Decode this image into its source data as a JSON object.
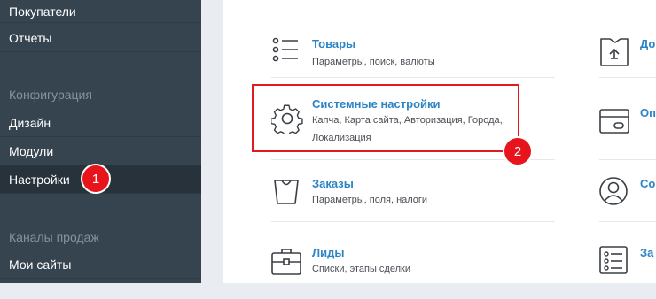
{
  "sidebar": {
    "items_top": [
      {
        "label": "Покупатели"
      },
      {
        "label": "Отчеты"
      }
    ],
    "section_config": "Конфигурация",
    "items_config": [
      {
        "label": "Дизайн"
      },
      {
        "label": "Модули"
      },
      {
        "label": "Настройки"
      }
    ],
    "section_sales": "Каналы продаж",
    "items_sales": [
      {
        "label": "Мои сайты"
      }
    ]
  },
  "markers": [
    "1",
    "2"
  ],
  "cards_left": [
    {
      "title": "Товары",
      "desc": "Параметры, поиск, валюты",
      "icon": "list-icon"
    },
    {
      "title": "Системные настройки",
      "desc_lines": [
        "Капча, Карта сайта, Авторизация, Города,",
        "Локализация"
      ],
      "icon": "gear-icon"
    },
    {
      "title": "Заказы",
      "desc": "Параметры, поля, налоги",
      "icon": "shopping-bag-icon"
    },
    {
      "title": "Лиды",
      "desc": "Списки, этапы сделки",
      "icon": "briefcase-icon"
    }
  ],
  "cards_right": [
    {
      "title": "До",
      "icon": "box-upload-icon"
    },
    {
      "title": "Оп",
      "icon": "credit-card-icon"
    },
    {
      "title": "Со",
      "icon": "user-circle-icon"
    },
    {
      "title": "За",
      "icon": "checklist-icon"
    }
  ],
  "colors": {
    "sidebar_bg": "#36444f",
    "sidebar_active": "#27323b",
    "accent": "#2b84c6",
    "marker": "#e8141b"
  }
}
